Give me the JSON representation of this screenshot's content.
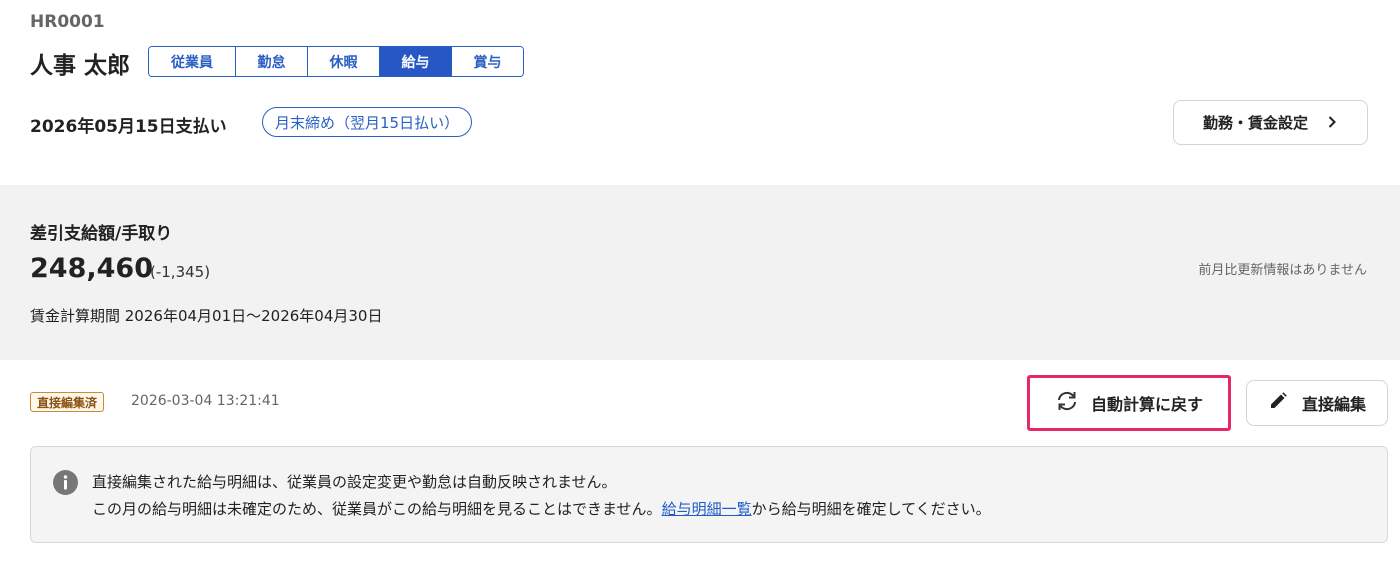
{
  "employee": {
    "code": "HR0001",
    "name": "人事 太郎"
  },
  "tabs": [
    {
      "label": "従業員",
      "active": false
    },
    {
      "label": "勤怠",
      "active": false
    },
    {
      "label": "休暇",
      "active": false
    },
    {
      "label": "給与",
      "active": true
    },
    {
      "label": "賞与",
      "active": false
    }
  ],
  "payment": {
    "date_label": "2026年05月15日支払い",
    "cutoff_badge": "月末締め（翌月15日払い）",
    "settings_button": "勤務・賃金設定"
  },
  "summary": {
    "label": "差引支給額/手取り",
    "amount": "248,460",
    "diff": "(-1,345)",
    "no_update_text": "前月比更新情報はありません",
    "period": "賃金計算期間 2026年04月01日～2026年04月30日"
  },
  "edit_status": {
    "badge": "直接編集済",
    "timestamp": "2026-03-04 13:21:41"
  },
  "actions": {
    "revert_label": "自動計算に戻す",
    "edit_label": "直接編集"
  },
  "notice": {
    "line1": "直接編集された給与明細は、従業員の設定変更や勤怠は自動反映されません。",
    "line2_before": "この月の給与明細は未確定のため、従業員がこの給与明細を見ることはできません。",
    "line2_link": "給与明細一覧",
    "line2_after": "から給与明細を確定してください。"
  },
  "colors": {
    "primary": "#2756c5",
    "highlight": "#e8266b",
    "summary_bg": "#f2f2f2",
    "badge_text": "#8a5213"
  },
  "icons": {
    "settings_arrow": "chevron-right-icon",
    "revert": "refresh-icon",
    "edit": "pencil-icon",
    "notice": "info-icon"
  }
}
